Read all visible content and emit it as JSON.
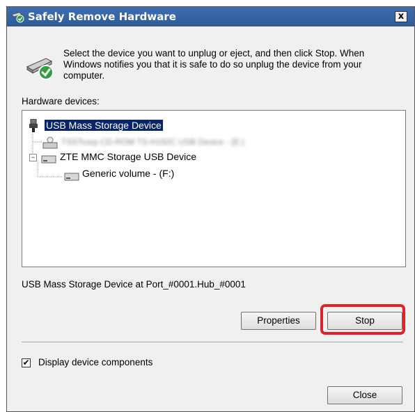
{
  "window": {
    "title": "Safely Remove Hardware",
    "close_glyph": "x"
  },
  "intro_text": "Select the device you want to unplug or eject, and then click Stop. When Windows notifies you that it is safe to do so unplug the device from your computer.",
  "hardware_label": "Hardware devices:",
  "tree": [
    {
      "label": "USB Mass Storage Device",
      "selected": true,
      "icon": "usb-plug-icon"
    },
    {
      "label": "TSSTcorp CD-ROM TS-H192C USB Device - (E:)",
      "blurred": true,
      "icon": "cdrom-icon"
    },
    {
      "label": "ZTE MMC Storage USB Device",
      "icon": "drive-icon"
    },
    {
      "label": "Generic volume - (F:)",
      "icon": "volume-icon"
    }
  ],
  "status_text": "USB Mass Storage Device at Port_#0001.Hub_#0001",
  "buttons": {
    "properties": "Properties",
    "stop": "Stop",
    "close": "Close"
  },
  "checkbox": {
    "label": "Display device components",
    "checked": true,
    "mark": "✔"
  },
  "colors": {
    "titlebar": "#3f6fb0",
    "selection": "#0a246a",
    "highlight": "#e0232b"
  }
}
